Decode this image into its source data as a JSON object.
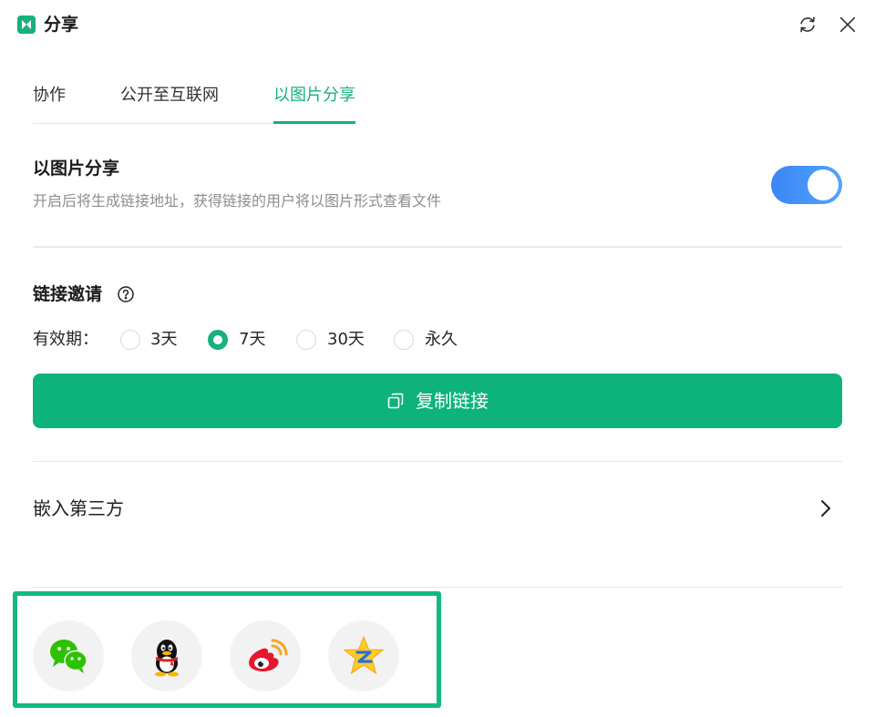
{
  "window": {
    "title": "分享",
    "logo_icon": "mindmaster-logo-icon",
    "refresh_icon": "refresh-icon",
    "close_icon": "close-icon"
  },
  "tabs": [
    {
      "label": "协作",
      "active": false
    },
    {
      "label": "公开至互联网",
      "active": false
    },
    {
      "label": "以图片分享",
      "active": true
    }
  ],
  "image_share": {
    "title": "以图片分享",
    "description": "开启后将生成链接地址，获得链接的用户将以图片形式查看文件",
    "enabled": true
  },
  "link_invite": {
    "title": "链接邀请",
    "help_icon": "question-circle-icon",
    "validity_label": "有效期：",
    "options": [
      {
        "label": "3天",
        "selected": false
      },
      {
        "label": "7天",
        "selected": true
      },
      {
        "label": "30天",
        "selected": false
      },
      {
        "label": "永久",
        "selected": false
      }
    ],
    "copy_button_label": "复制链接",
    "copy_icon": "copy-icon"
  },
  "embed": {
    "label": "嵌入第三方",
    "icon": "chevron-right-icon"
  },
  "share_targets": [
    {
      "name": "wechat",
      "icon": "wechat-icon"
    },
    {
      "name": "qq",
      "icon": "qq-icon"
    },
    {
      "name": "weibo",
      "icon": "weibo-icon"
    },
    {
      "name": "qzone",
      "icon": "qzone-icon"
    }
  ],
  "colors": {
    "accent": "#17b07e",
    "button": "#0db37b",
    "toggle": "#3a86f5",
    "highlight_border": "#13b981"
  }
}
